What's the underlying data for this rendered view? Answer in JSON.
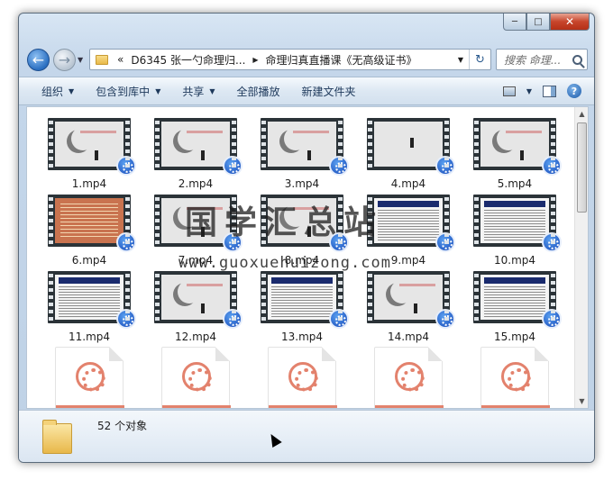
{
  "window": {
    "controls": {
      "minimize": "─",
      "maximize": "□",
      "close": "✕"
    }
  },
  "nav": {
    "back_icon": "←",
    "forward_icon": "→",
    "dropdown": "▼"
  },
  "address": {
    "prefix": "«",
    "crumbs": [
      "D6345 张一勺命理归...",
      "命理归真直播课《无高级证书》"
    ],
    "separator": "▶",
    "dropdown": "▼",
    "refresh_icon": "↻"
  },
  "search": {
    "placeholder": "搜索 命理..."
  },
  "toolbar": {
    "organize": "组织",
    "include_in_library": "包含到库中",
    "share": "共享",
    "play_all": "全部播放",
    "new_folder": "新建文件夹",
    "dropdown_arrow": "▼",
    "help": "?"
  },
  "files": [
    {
      "name": "1.mp4",
      "thumb": "moon"
    },
    {
      "name": "2.mp4",
      "thumb": "moon"
    },
    {
      "name": "3.mp4",
      "thumb": "moon"
    },
    {
      "name": "4.mp4",
      "thumb": "figure"
    },
    {
      "name": "5.mp4",
      "thumb": "moon"
    },
    {
      "name": "6.mp4",
      "thumb": "red"
    },
    {
      "name": "7.mp4",
      "thumb": "moon"
    },
    {
      "name": "8.mp4",
      "thumb": "moon"
    },
    {
      "name": "9.mp4",
      "thumb": "doc"
    },
    {
      "name": "10.mp4",
      "thumb": "doc"
    },
    {
      "name": "11.mp4",
      "thumb": "doc"
    },
    {
      "name": "12.mp4",
      "thumb": "moon"
    },
    {
      "name": "13.mp4",
      "thumb": "doc"
    },
    {
      "name": "14.mp4",
      "thumb": "moon"
    },
    {
      "name": "15.mp4",
      "thumb": "doc"
    },
    {
      "name": "",
      "thumb": "video-file"
    },
    {
      "name": "",
      "thumb": "video-file"
    },
    {
      "name": "",
      "thumb": "video-file"
    },
    {
      "name": "",
      "thumb": "video-file"
    },
    {
      "name": "",
      "thumb": "video-file"
    }
  ],
  "watermark": {
    "text": "国学汇总站",
    "url": "www.guoxuehuizong.com"
  },
  "status": {
    "count": "52 个对象"
  },
  "scrollbar": {
    "up": "▲",
    "down": "▼"
  }
}
